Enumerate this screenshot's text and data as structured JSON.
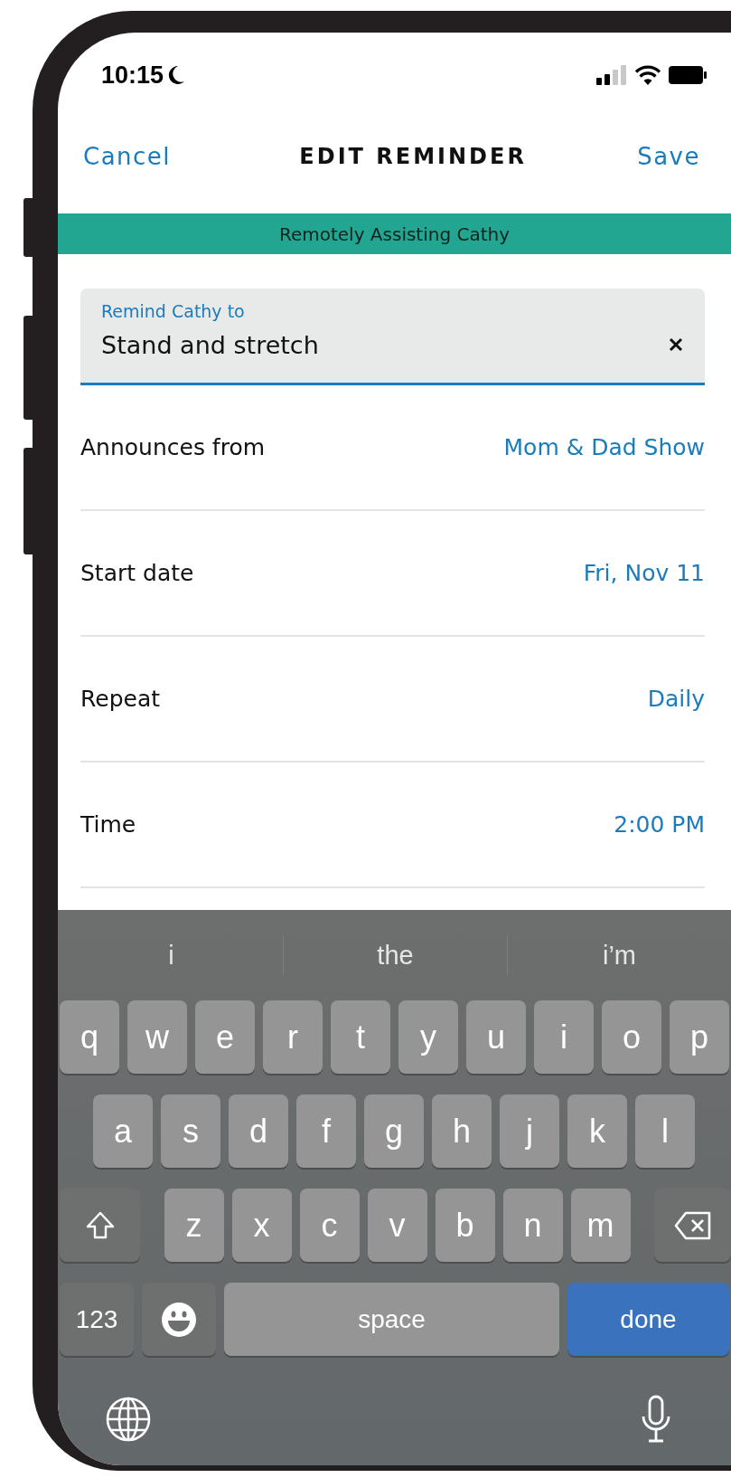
{
  "status_bar": {
    "time": "10:15"
  },
  "nav": {
    "cancel": "Cancel",
    "title": "EDIT REMINDER",
    "save": "Save"
  },
  "banner": "Remotely Assisting Cathy",
  "reminder_field": {
    "label": "Remind Cathy to",
    "value": "Stand and stretch"
  },
  "settings": [
    {
      "label": "Announces from",
      "value": "Mom & Dad Show"
    },
    {
      "label": "Start date",
      "value": "Fri, Nov 11"
    },
    {
      "label": "Repeat",
      "value": "Daily"
    },
    {
      "label": "Time",
      "value": "2:00 PM"
    }
  ],
  "keyboard": {
    "suggestions": [
      "i",
      "the",
      "i’m"
    ],
    "rows": [
      {
        "keys": [
          {
            "kind": "letter",
            "label": "q"
          },
          {
            "kind": "letter",
            "label": "w"
          },
          {
            "kind": "letter",
            "label": "e"
          },
          {
            "kind": "letter",
            "label": "r"
          },
          {
            "kind": "letter",
            "label": "t"
          },
          {
            "kind": "letter",
            "label": "y"
          },
          {
            "kind": "letter",
            "label": "u"
          },
          {
            "kind": "letter",
            "label": "i"
          },
          {
            "kind": "letter",
            "label": "o"
          },
          {
            "kind": "letter",
            "label": "p"
          }
        ]
      },
      {
        "keys": [
          {
            "kind": "letter",
            "label": "a"
          },
          {
            "kind": "letter",
            "label": "s"
          },
          {
            "kind": "letter",
            "label": "d"
          },
          {
            "kind": "letter",
            "label": "f"
          },
          {
            "kind": "letter",
            "label": "g"
          },
          {
            "kind": "letter",
            "label": "h"
          },
          {
            "kind": "letter",
            "label": "j"
          },
          {
            "kind": "letter",
            "label": "k"
          },
          {
            "kind": "letter",
            "label": "l"
          }
        ]
      },
      {
        "keys": [
          {
            "kind": "shift"
          },
          {
            "kind": "letter",
            "label": "z"
          },
          {
            "kind": "letter",
            "label": "x"
          },
          {
            "kind": "letter",
            "label": "c"
          },
          {
            "kind": "letter",
            "label": "v"
          },
          {
            "kind": "letter",
            "label": "b"
          },
          {
            "kind": "letter",
            "label": "n"
          },
          {
            "kind": "letter",
            "label": "m"
          },
          {
            "kind": "delete"
          }
        ]
      }
    ],
    "bottom_row": [
      {
        "kind": "mode",
        "label": "123"
      },
      {
        "kind": "emoji"
      },
      {
        "kind": "space",
        "label": "space"
      },
      {
        "kind": "done",
        "label": "done"
      }
    ]
  }
}
